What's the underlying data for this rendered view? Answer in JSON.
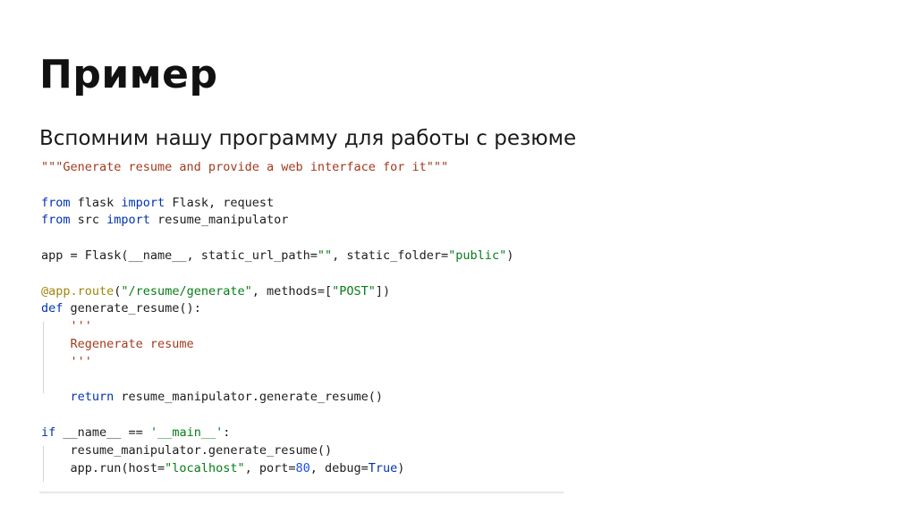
{
  "slide": {
    "title": "Пример",
    "subtitle": "Вспомним нашу программу для работы с резюме"
  },
  "code": {
    "language": "python",
    "lines": [
      "\"\"\"Generate resume and provide a web interface for it\"\"\"",
      "",
      "from flask import Flask, request",
      "from src import resume_manipulator",
      "",
      "app = Flask(__name__, static_url_path=\"\", static_folder=\"public\")",
      "",
      "@app.route(\"/resume/generate\", methods=[\"POST\"])",
      "def generate_resume():",
      "    '''",
      "    Regenerate resume",
      "    '''",
      "",
      "    return resume_manipulator.generate_resume()",
      "",
      "if __name__ == '__main__':",
      "    resume_manipulator.generate_resume()",
      "    app.run(host=\"localhost\", port=80, debug=True)"
    ]
  },
  "colors": {
    "keyword": "#0033b3",
    "string": "#067d17",
    "docstring": "#a33a1f",
    "number": "#1750eb",
    "decorator": "#9e880d",
    "text": "#1d1d1d"
  }
}
